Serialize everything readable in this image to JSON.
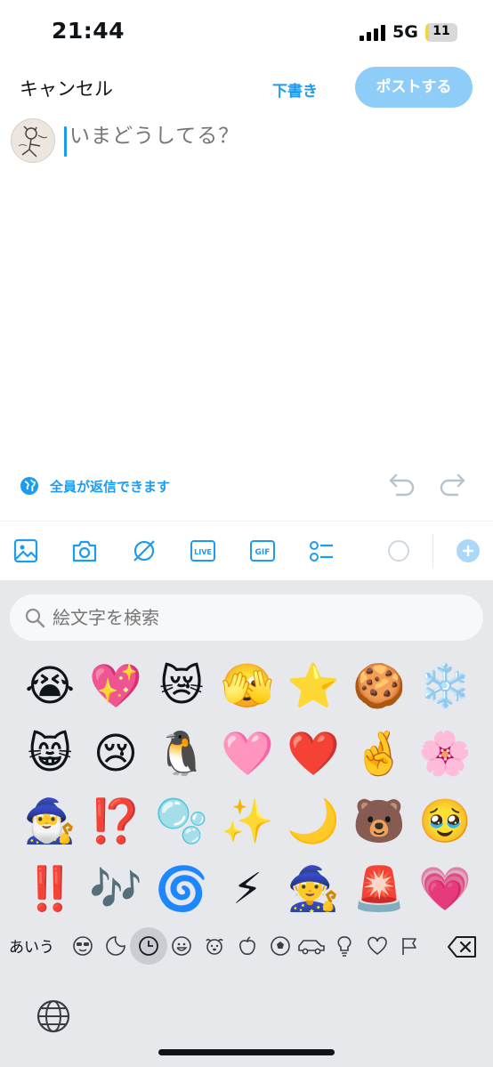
{
  "status_bar": {
    "time": "21:44",
    "network": "5G",
    "battery": "11",
    "battery_level": 0.11
  },
  "compose": {
    "cancel_label": "キャンセル",
    "drafts_label": "下書き",
    "post_label": "ポストする",
    "placeholder": "いまどうしてる？",
    "reply_setting_label": "全員が返信できます"
  },
  "toolbar": {
    "icons": [
      "image-icon",
      "camera-icon",
      "hidden-icon",
      "live-icon",
      "gif-icon",
      "poll-icon",
      "progress-ring-icon",
      "add-post-icon"
    ],
    "live_label": "LIVE",
    "gif_label": "GIF"
  },
  "emoji_keyboard": {
    "search_placeholder": "絵文字を検索",
    "emojis": [
      "😭",
      "💖",
      "😿",
      "🫣",
      "⭐",
      "🍪",
      "❄️",
      "😸",
      "😢",
      "🐧",
      "🩷",
      "❤️",
      "🤞",
      "🌸",
      "🧙‍♂️",
      "⁉️",
      "🫧",
      "✨",
      "🌙",
      "🐻",
      "🥹",
      "‼️",
      "🎶",
      "🌀",
      "⚡",
      "🧙",
      "🚨",
      "💗"
    ],
    "keyboard_switch_label": "あいう",
    "categories": [
      "smileys-people-icon",
      "stickers-icon",
      "recent-icon",
      "smiley-icon",
      "animals-icon",
      "food-icon",
      "activity-icon",
      "travel-icon",
      "objects-icon",
      "symbols-icon",
      "flags-icon"
    ]
  },
  "colors": {
    "accent": "#1d9bf0",
    "post_disabled": "#8ecdf8",
    "keyboard_bg": "#e6e8ec"
  }
}
